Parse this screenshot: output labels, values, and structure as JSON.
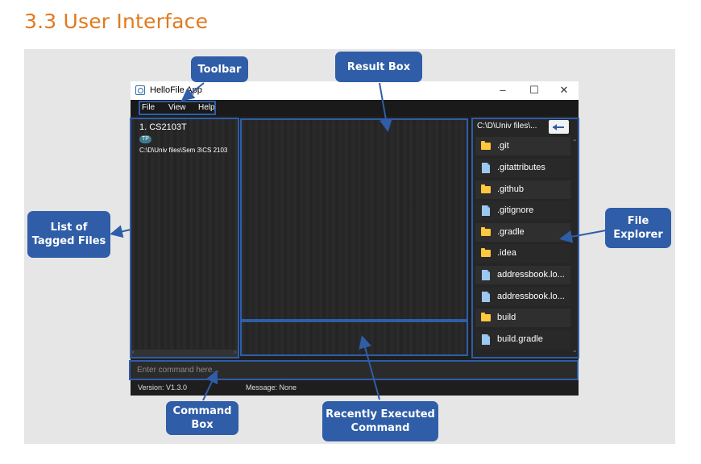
{
  "heading": "3.3 User Interface",
  "window": {
    "title": "HelloFile App",
    "controls": {
      "minimize": "–",
      "maximize": "☐",
      "close": "✕"
    }
  },
  "menu": [
    "File",
    "View",
    "Help"
  ],
  "tagged_files": [
    {
      "index_name": "1.  CS2103T",
      "tag": "TP",
      "path": "C:\\D\\Univ files\\Sem 3\\CS 2103"
    }
  ],
  "explorer": {
    "path": "C:\\D\\Univ files\\...",
    "files": [
      {
        "name": ".git",
        "icon": "folder-icon"
      },
      {
        "name": ".gitattributes",
        "icon": "file-icon"
      },
      {
        "name": ".github",
        "icon": "folder-icon"
      },
      {
        "name": ".gitignore",
        "icon": "file-icon"
      },
      {
        "name": ".gradle",
        "icon": "folder-icon"
      },
      {
        "name": ".idea",
        "icon": "folder-icon"
      },
      {
        "name": "addressbook.lo...",
        "icon": "file-icon"
      },
      {
        "name": "addressbook.lo...",
        "icon": "file-icon"
      },
      {
        "name": "build",
        "icon": "folder-icon"
      },
      {
        "name": "build.gradle",
        "icon": "file-icon"
      }
    ]
  },
  "command": {
    "placeholder": "Enter command here..."
  },
  "status": {
    "version": "Version:  V1.3.0",
    "message": "Message:  None"
  },
  "callouts": {
    "toolbar": "Toolbar",
    "result_box": "Result Box",
    "tagged_files": "List of Tagged Files",
    "file_explorer": "File Explorer",
    "command_box": "Command Box",
    "recent_command": "Recently Executed Command"
  },
  "colors": {
    "heading": "#e07a1f",
    "callout": "#2f5da8",
    "folder": "#ffc83d",
    "file": "#9cc8f0"
  }
}
